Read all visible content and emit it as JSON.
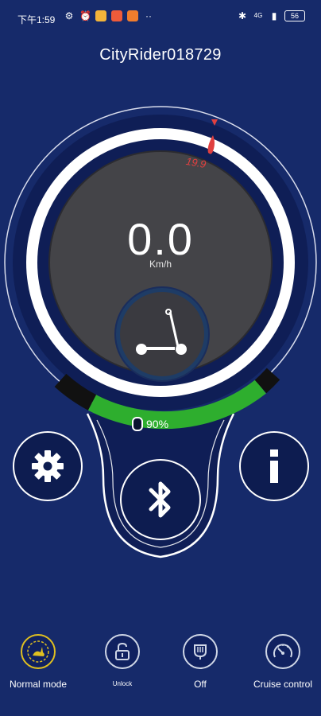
{
  "status_bar": {
    "time": "下午1:59",
    "network": "4G",
    "battery": "56"
  },
  "title": "CityRider018729",
  "speed": {
    "value": "0.0",
    "unit": "Km/h",
    "max_marker": "19.9"
  },
  "battery": {
    "percent": "90%"
  },
  "buttons": {
    "settings": "settings",
    "bluetooth": "bluetooth",
    "info": "info"
  },
  "bottom_bar": [
    {
      "label": "Normal mode",
      "icon": "rabbit-mode-icon"
    },
    {
      "label": "Unlock",
      "icon": "lock-icon"
    },
    {
      "label": "Off",
      "icon": "light-icon"
    },
    {
      "label": "Cruise control",
      "icon": "speedometer-icon"
    }
  ],
  "colors": {
    "background": "#162a6a",
    "dial_dark": "#0f1e56",
    "gauge_inner": "#444448",
    "battery_green": "#2eae2e",
    "max_marker": "#e04040",
    "mode_yellow": "#e0c020"
  }
}
